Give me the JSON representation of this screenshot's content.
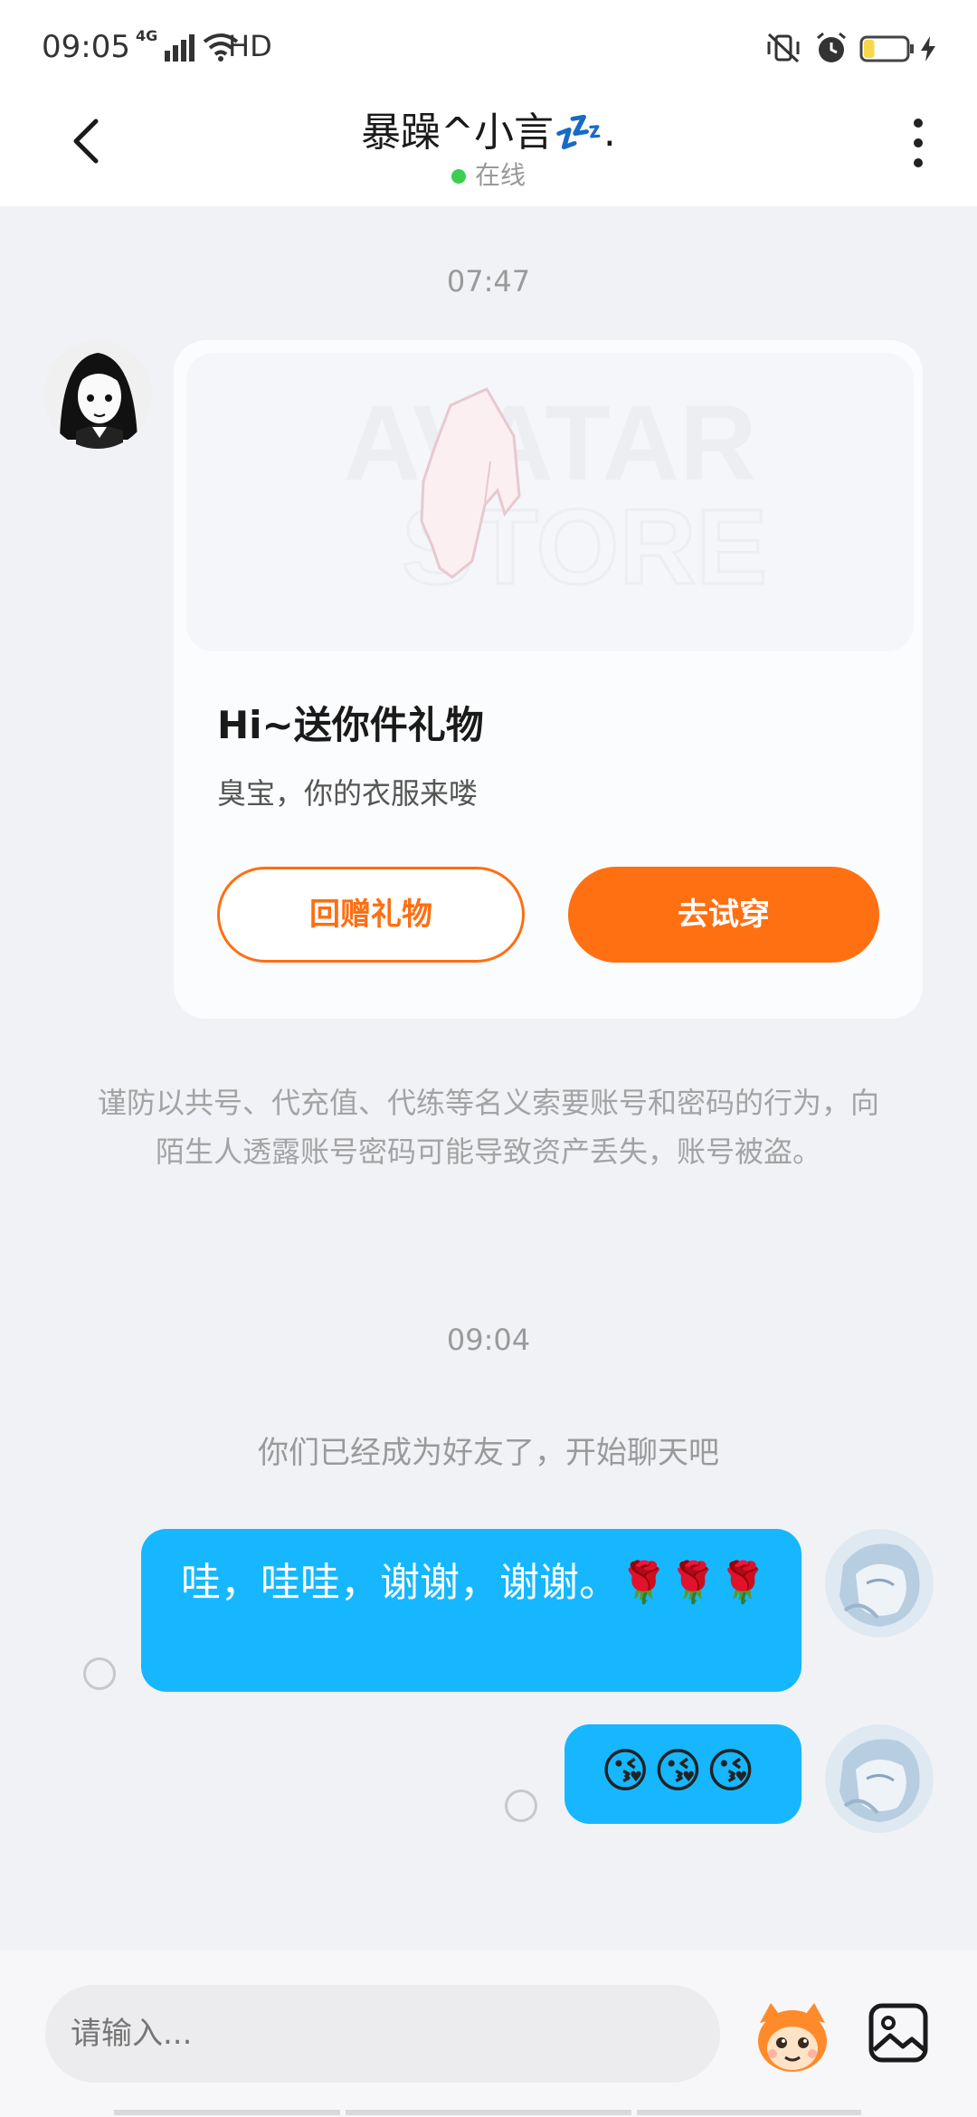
{
  "status_bar": {
    "time": "09:05",
    "network": "4G",
    "hd": "HD",
    "battery_level": 0.25
  },
  "header": {
    "title": "暴躁^小言💤.",
    "status": "在线"
  },
  "chat": {
    "timestamp_1": "07:47",
    "gift_card": {
      "image_text": "AVATAR STORE",
      "title": "Hi~送你件礼物",
      "subtitle": "臭宝，你的衣服来喽",
      "return_gift_label": "回赠礼物",
      "try_on_label": "去试穿"
    },
    "warning": "谨防以共号、代充值、代练等名义索要账号和密码的行为，向陌生人透露账号密码可能导致资产丢失，账号被盗。",
    "timestamp_2": "09:04",
    "system_message": "你们已经成为好友了，开始聊天吧",
    "messages": [
      {
        "text": "哇，哇哇，谢谢，谢谢。🌹🌹🌹"
      },
      {
        "text": "😘😘😘"
      }
    ]
  },
  "input": {
    "placeholder": "请输入..."
  },
  "colors": {
    "accent_orange": "#ff7013",
    "bubble_blue": "#16b7ff",
    "online_green": "#3ccf4e"
  }
}
